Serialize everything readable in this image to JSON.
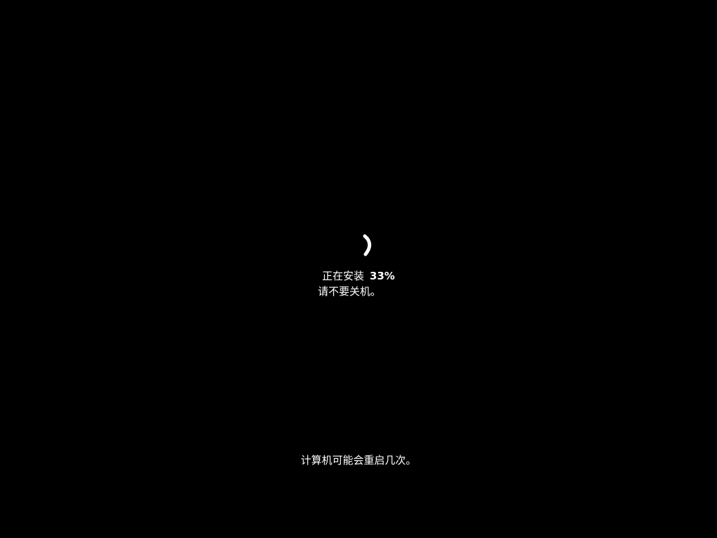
{
  "installing_label": "正在安装",
  "progress_percent": "33%",
  "do_not_power_off": "请不要关机。",
  "restart_notice": "计算机可能会重启几次。",
  "spinner_icon": "loading-spinner-icon",
  "colors": {
    "background": "#000000",
    "text": "#ffffff"
  }
}
